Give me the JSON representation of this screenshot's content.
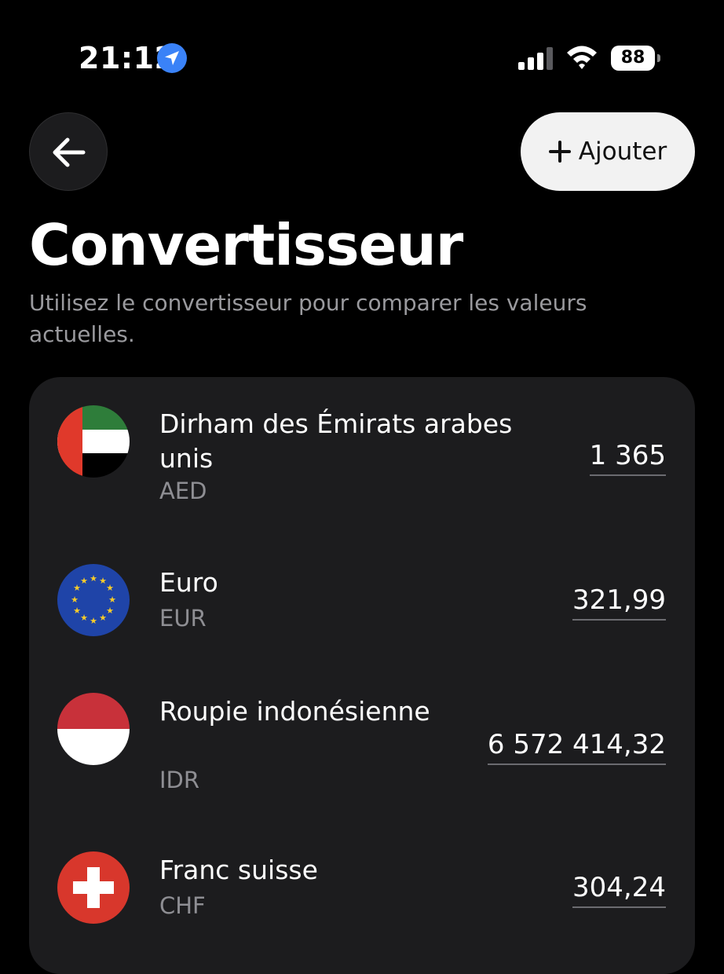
{
  "status_bar": {
    "time": "21:12",
    "battery": "88"
  },
  "header": {
    "add_label": "Ajouter"
  },
  "page": {
    "title": "Convertisseur",
    "subtitle": "Utilisez le convertisseur pour comparer les valeurs actuelles."
  },
  "currencies": [
    {
      "name": "Dirham des Émirats arabes unis",
      "code": "AED",
      "value": "1 365"
    },
    {
      "name": "Euro",
      "code": "EUR",
      "value": "321,99"
    },
    {
      "name": "Roupie indonésienne",
      "code": "IDR",
      "value": "6 572 414,32"
    },
    {
      "name": "Franc suisse",
      "code": "CHF",
      "value": "304,24"
    }
  ],
  "colors": {
    "background": "#000000",
    "card": "#1c1c1e",
    "secondary_text": "#9a9a9e",
    "location_accent": "#3a82f7",
    "add_button_bg": "#f2f2f2"
  },
  "icons": {
    "back": "arrow-left-icon",
    "add": "plus-icon",
    "location": "location-arrow-icon",
    "signal": "cellular-signal-icon",
    "wifi": "wifi-icon",
    "battery": "battery-icon"
  }
}
